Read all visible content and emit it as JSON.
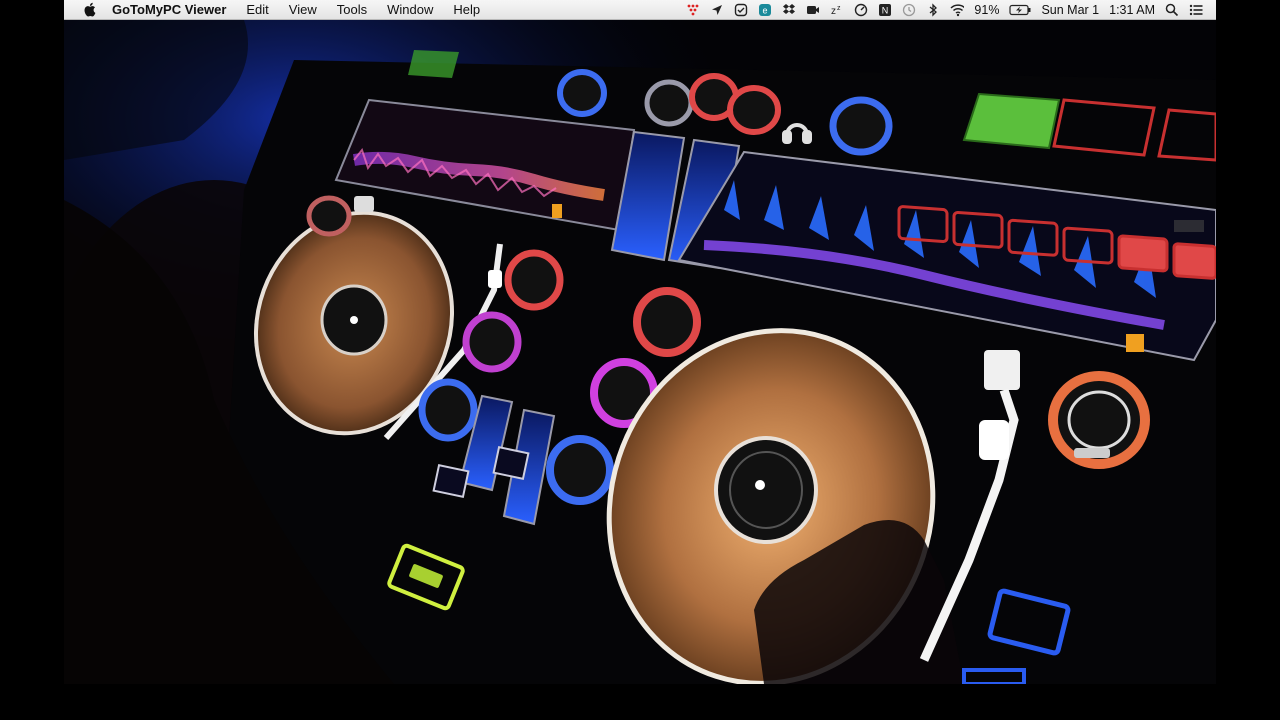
{
  "menubar": {
    "app_name": "GoToMyPC Viewer",
    "menus": [
      "Edit",
      "View",
      "Tools",
      "Window",
      "Help"
    ],
    "battery": "91%",
    "date": "Sun Mar 1",
    "time": "1:31 AM"
  },
  "icons": {
    "apple": "apple-logo-icon",
    "status": [
      "record-dots-icon",
      "location-arrow-icon",
      "checkbox-icon",
      "e-circle-icon",
      "dropbox-icon",
      "camera-icon",
      "sleep-z-icon",
      "speedometer-icon",
      "n-box-icon",
      "time-machine-icon",
      "bluetooth-icon",
      "wifi-icon",
      "battery-icon",
      "search-icon",
      "list-icon"
    ]
  },
  "colors": {
    "menubar_bg": "#ececec",
    "platter": "#c98a52",
    "green_pad": "#5bbf3c",
    "red_pad": "#e04848",
    "blue_ring": "#3c6cf0",
    "magenta_ring": "#d040e0",
    "waveform_blue": "#2f6cff",
    "waveform_purple": "#a060ff"
  }
}
